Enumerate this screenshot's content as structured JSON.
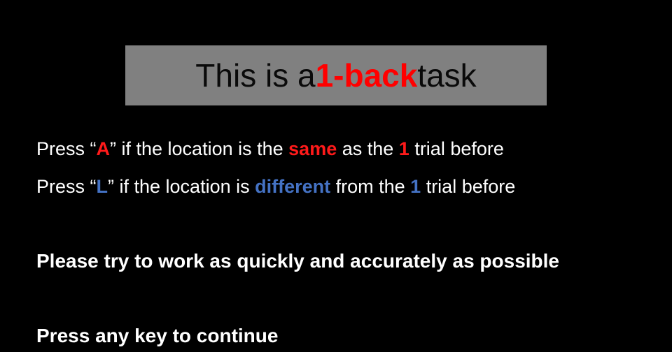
{
  "title": {
    "prefix": "This is a ",
    "highlight": "1-back",
    "suffix": " task",
    "highlight_color": "#ff0000",
    "box_color": "#808080"
  },
  "instructions": {
    "line1": {
      "p1": "Press “",
      "key": "A",
      "p2": "” if the location is the ",
      "word": "same",
      "p3": " as the ",
      "num": "1",
      "p4": " trial before"
    },
    "line2": {
      "p1": "Press “",
      "key": "L",
      "p2": "” if the location is ",
      "word": "different",
      "p3": " from the ",
      "num": "1",
      "p4": " trial before"
    },
    "speed_note": "Please try to work as quickly and accurately as possible",
    "continue_prompt": "Press any key to continue"
  },
  "colors": {
    "background": "#000000",
    "same_color": "#ff1a1a",
    "different_color": "#4472c4",
    "text": "#ffffff"
  }
}
